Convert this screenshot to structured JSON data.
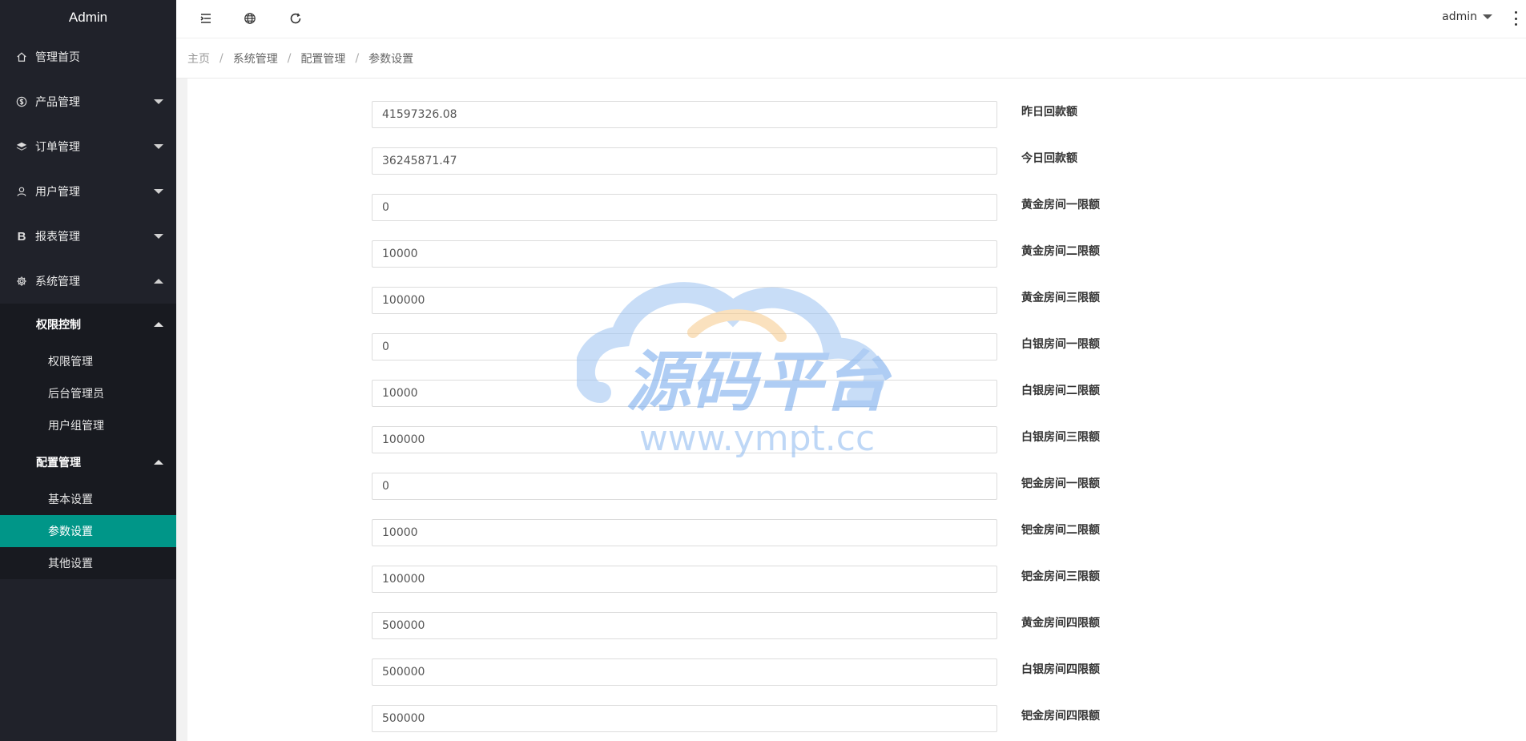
{
  "app": {
    "title": "Admin"
  },
  "header": {
    "user": "admin"
  },
  "sidebar": {
    "items": [
      {
        "label": "管理首页"
      },
      {
        "label": "产品管理"
      },
      {
        "label": "订单管理"
      },
      {
        "label": "用户管理"
      },
      {
        "label": "报表管理"
      },
      {
        "label": "系统管理"
      }
    ],
    "groups": [
      {
        "label": "权限控制",
        "items": [
          "权限管理",
          "后台管理员",
          "用户组管理"
        ]
      },
      {
        "label": "配置管理",
        "items": [
          "基本设置",
          "参数设置",
          "其他设置"
        ]
      }
    ]
  },
  "breadcrumb": [
    "主页",
    "系统管理",
    "配置管理",
    "参数设置"
  ],
  "form": {
    "rows": [
      {
        "label": "昨日回款额:",
        "value": "41597326.08",
        "tip": "昨日回款额"
      },
      {
        "label": "今日回款额:",
        "value": "36245871.47",
        "tip": "今日回款额"
      },
      {
        "label": "黄金房间一限额:",
        "value": "0",
        "tip": "黄金房间一限额"
      },
      {
        "label": "黄金房间二限额:",
        "value": "10000",
        "tip": "黄金房间二限额"
      },
      {
        "label": "黄金房间三限额:",
        "value": "100000",
        "tip": "黄金房间三限额"
      },
      {
        "label": "白银房间一限额:",
        "value": "0",
        "tip": "白银房间一限额"
      },
      {
        "label": "白银房间二限额:",
        "value": "10000",
        "tip": "白银房间二限额"
      },
      {
        "label": "白银房间三限额:",
        "value": "100000",
        "tip": "白银房间三限额"
      },
      {
        "label": "钯金房间一限额:",
        "value": "0",
        "tip": "钯金房间一限额"
      },
      {
        "label": "钯金房间二限额:",
        "value": "10000",
        "tip": "钯金房间二限额"
      },
      {
        "label": "钯金房间三限额:",
        "value": "100000",
        "tip": "钯金房间三限额"
      },
      {
        "label": "黄金房间四限额:",
        "value": "500000",
        "tip": "黄金房间四限额"
      },
      {
        "label": "白银房间四限额:",
        "value": "500000",
        "tip": "白银房间四限额"
      },
      {
        "label": "钯金房间四限额:",
        "value": "500000",
        "tip": "钯金房间四限额"
      }
    ]
  },
  "watermark": {
    "title": "源码平台",
    "url": "www.ympt.cc"
  },
  "colors": {
    "sidebar_bg": "#20222a",
    "active": "#009688",
    "watermark": "#7fb2f0"
  }
}
